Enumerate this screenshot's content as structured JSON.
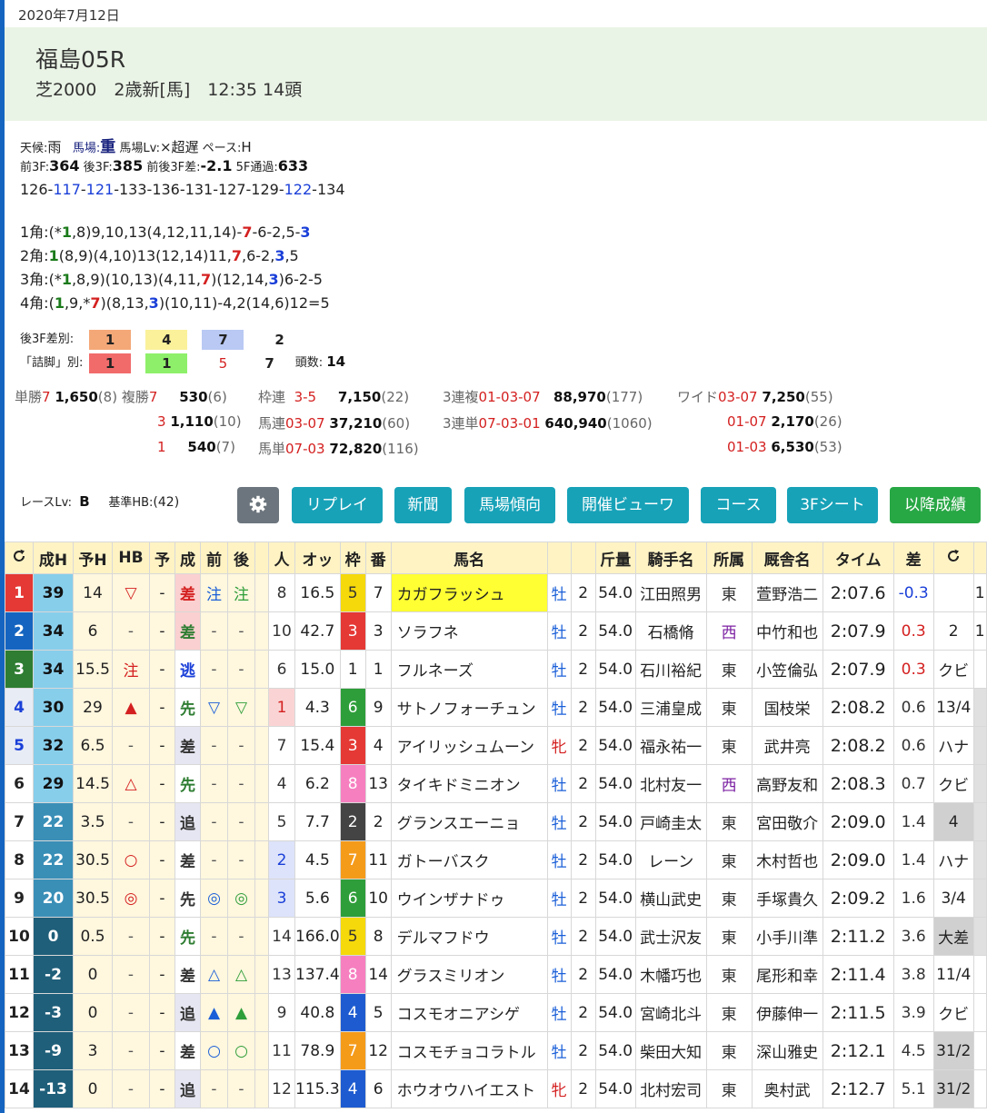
{
  "date": "2020年7月12日",
  "race": {
    "title": "福島05R",
    "detail": "芝2000　2歳新[馬]　12:35 14頭"
  },
  "conditions": {
    "weather_label": "天候:",
    "weather": "雨",
    "track_label": "馬場:",
    "track": "重",
    "tracklv_label": "馬場Lv:",
    "tracklv": "×超遅",
    "pace_label": "ペース:",
    "pace": "H"
  },
  "splits": {
    "f3_label": "前3F:",
    "f3": "364",
    "l3_label": "後3F:",
    "l3": "385",
    "diff_label": "前後3F差:",
    "diff": "-2.1",
    "f5_label": "5F通過:",
    "f5": "633",
    "laps": [
      "126",
      "117",
      "121",
      "133",
      "136",
      "131",
      "127",
      "129",
      "122",
      "134"
    ]
  },
  "corners": [
    "1角:(*1,8)9,10,13(4,12,11,14)-7-6-2,5-3",
    "2角:1(8,9)(4,10)13(12,14)11,7,6-2,3,5",
    "3角:(*1,8,9)(10,13)(4,11,7)(12,14,3)6-2-5",
    "4角:(1,9,*7)(8,13,3)(10,11)-4,2(14,6)12=5"
  ],
  "rank3f": {
    "label": "後3F差別:",
    "values": [
      "1",
      "4",
      "7",
      "2"
    ]
  },
  "tsume": {
    "label": "「詰脚」別:",
    "values": [
      "1",
      "1",
      "5",
      "7"
    ],
    "count_label": "頭数:",
    "count": "14"
  },
  "payouts": {
    "tansho": {
      "label": "単勝",
      "no": "7",
      "pay": "1,650",
      "pop": "(8)"
    },
    "fukusho_label": "複勝",
    "fukusho": [
      {
        "no": "7",
        "pay": "530",
        "pop": "(6)"
      },
      {
        "no": "3",
        "pay": "1,110",
        "pop": "(10)"
      },
      {
        "no": "1",
        "pay": "540",
        "pop": "(7)"
      }
    ],
    "wakuren": {
      "label": "枠連",
      "combo": "3-5",
      "pay": "7,150",
      "pop": "(22)"
    },
    "umaren": {
      "label": "馬連",
      "combo": "03-07",
      "pay": "37,210",
      "pop": "(60)"
    },
    "umatan": {
      "label": "馬単",
      "combo": "07-03",
      "pay": "72,820",
      "pop": "(116)"
    },
    "sanrenpuku": {
      "label": "3連複",
      "combo": "01-03-07",
      "pay": "88,970",
      "pop": "(177)"
    },
    "sanrentan": {
      "label": "3連単",
      "combo": "07-03-01",
      "pay": "640,940",
      "pop": "(1060)"
    },
    "wide_label": "ワイド",
    "wide": [
      {
        "combo": "03-07",
        "pay": "7,250",
        "pop": "(55)"
      },
      {
        "combo": "01-07",
        "pay": "2,170",
        "pop": "(26)"
      },
      {
        "combo": "01-03",
        "pay": "6,530",
        "pop": "(53)"
      }
    ]
  },
  "racelv": {
    "label": "レースLv:",
    "value": "B",
    "hb_label": "基準HB:",
    "hb": "(42)"
  },
  "buttons": [
    "リプレイ",
    "新聞",
    "馬場傾向",
    "開催ビューワ",
    "コース",
    "3Fシート",
    "以降成績"
  ],
  "table": {
    "headers": [
      "成H",
      "予H",
      "HB",
      "予",
      "成",
      "前",
      "後",
      "人",
      "オッ",
      "枠",
      "番",
      "馬名",
      "",
      "",
      "斤量",
      "騎手名",
      "所属",
      "厩舎名",
      "タイム",
      "差"
    ],
    "rows": [
      {
        "rank": "1",
        "seiH": "39",
        "yoH": "14",
        "hb": "▽",
        "yo": "-",
        "sei": "差",
        "mae": "注",
        "ato": "注",
        "pop": "8",
        "odds": "16.5",
        "waku": "5",
        "ban": "7",
        "name": "カガフラッシュ",
        "sex": "牡",
        "age": "2",
        "kin": "54.0",
        "jockey": "江田照男",
        "aff": "東",
        "trainer": "萱野浩二",
        "time": "2:07.6",
        "diff": "-0.3",
        "margin": "",
        "x": "1"
      },
      {
        "rank": "2",
        "seiH": "34",
        "yoH": "6",
        "hb": "-",
        "yo": "-",
        "sei": "差",
        "mae": "-",
        "ato": "-",
        "pop": "10",
        "odds": "42.7",
        "waku": "3",
        "ban": "3",
        "name": "ソラフネ",
        "sex": "牡",
        "age": "2",
        "kin": "54.0",
        "jockey": "石橋脩",
        "aff": "西",
        "trainer": "中竹和也",
        "time": "2:07.9",
        "diff": "0.3",
        "margin": "2",
        "x": "1"
      },
      {
        "rank": "3",
        "seiH": "34",
        "yoH": "15.5",
        "hb": "注",
        "yo": "-",
        "sei": "逃",
        "mae": "-",
        "ato": "-",
        "pop": "6",
        "odds": "15.0",
        "waku": "1",
        "ban": "1",
        "name": "フルネーズ",
        "sex": "牡",
        "age": "2",
        "kin": "54.0",
        "jockey": "石川裕紀",
        "aff": "東",
        "trainer": "小笠倫弘",
        "time": "2:07.9",
        "diff": "0.3",
        "margin": "クビ",
        "x": ""
      },
      {
        "rank": "4",
        "seiH": "30",
        "yoH": "29",
        "hb": "▲",
        "yo": "-",
        "sei": "先",
        "mae": "▽",
        "ato": "▽",
        "pop": "1",
        "odds": "4.3",
        "waku": "6",
        "ban": "9",
        "name": "サトノフォーチュン",
        "sex": "牡",
        "age": "2",
        "kin": "54.0",
        "jockey": "三浦皇成",
        "aff": "東",
        "trainer": "国枝栄",
        "time": "2:08.2",
        "diff": "0.6",
        "margin": "13/4",
        "x": ""
      },
      {
        "rank": "5",
        "seiH": "32",
        "yoH": "6.5",
        "hb": "-",
        "yo": "-",
        "sei": "差",
        "mae": "-",
        "ato": "-",
        "pop": "7",
        "odds": "15.4",
        "waku": "3",
        "ban": "4",
        "name": "アイリッシュムーン",
        "sex": "牝",
        "age": "2",
        "kin": "54.0",
        "jockey": "福永祐一",
        "aff": "東",
        "trainer": "武井亮",
        "time": "2:08.2",
        "diff": "0.6",
        "margin": "ハナ",
        "x": ""
      },
      {
        "rank": "6",
        "seiH": "29",
        "yoH": "14.5",
        "hb": "△",
        "yo": "-",
        "sei": "先",
        "mae": "-",
        "ato": "-",
        "pop": "4",
        "odds": "6.2",
        "waku": "8",
        "ban": "13",
        "name": "タイキドミニオン",
        "sex": "牡",
        "age": "2",
        "kin": "54.0",
        "jockey": "北村友一",
        "aff": "西",
        "trainer": "高野友和",
        "time": "2:08.3",
        "diff": "0.7",
        "margin": "クビ",
        "x": ""
      },
      {
        "rank": "7",
        "seiH": "22",
        "yoH": "3.5",
        "hb": "-",
        "yo": "-",
        "sei": "追",
        "mae": "-",
        "ato": "-",
        "pop": "5",
        "odds": "7.7",
        "waku": "2",
        "ban": "2",
        "name": "グランスエーニョ",
        "sex": "牡",
        "age": "2",
        "kin": "54.0",
        "jockey": "戸崎圭太",
        "aff": "東",
        "trainer": "宮田敬介",
        "time": "2:09.0",
        "diff": "1.4",
        "margin": "4",
        "x": ""
      },
      {
        "rank": "8",
        "seiH": "22",
        "yoH": "30.5",
        "hb": "○",
        "yo": "-",
        "sei": "差",
        "mae": "-",
        "ato": "-",
        "pop": "2",
        "odds": "4.5",
        "waku": "7",
        "ban": "11",
        "name": "ガトーバスク",
        "sex": "牡",
        "age": "2",
        "kin": "54.0",
        "jockey": "レーン",
        "aff": "東",
        "trainer": "木村哲也",
        "time": "2:09.0",
        "diff": "1.4",
        "margin": "ハナ",
        "x": ""
      },
      {
        "rank": "9",
        "seiH": "20",
        "yoH": "30.5",
        "hb": "◎",
        "yo": "-",
        "sei": "先",
        "mae": "◎",
        "ato": "◎",
        "pop": "3",
        "odds": "5.6",
        "waku": "6",
        "ban": "10",
        "name": "ウインザナドゥ",
        "sex": "牡",
        "age": "2",
        "kin": "54.0",
        "jockey": "横山武史",
        "aff": "東",
        "trainer": "手塚貴久",
        "time": "2:09.2",
        "diff": "1.6",
        "margin": "3/4",
        "x": ""
      },
      {
        "rank": "10",
        "seiH": "0",
        "yoH": "0.5",
        "hb": "-",
        "yo": "-",
        "sei": "先",
        "mae": "-",
        "ato": "-",
        "pop": "14",
        "odds": "166.0",
        "waku": "5",
        "ban": "8",
        "name": "デルマフドウ",
        "sex": "牡",
        "age": "2",
        "kin": "54.0",
        "jockey": "武士沢友",
        "aff": "東",
        "trainer": "小手川準",
        "time": "2:11.2",
        "diff": "3.6",
        "margin": "大差",
        "x": ""
      },
      {
        "rank": "11",
        "seiH": "-2",
        "yoH": "0",
        "hb": "-",
        "yo": "-",
        "sei": "差",
        "mae": "△",
        "ato": "△",
        "pop": "13",
        "odds": "137.4",
        "waku": "8",
        "ban": "14",
        "name": "グラスミリオン",
        "sex": "牡",
        "age": "2",
        "kin": "54.0",
        "jockey": "木幡巧也",
        "aff": "東",
        "trainer": "尾形和幸",
        "time": "2:11.4",
        "diff": "3.8",
        "margin": "11/4",
        "x": ""
      },
      {
        "rank": "12",
        "seiH": "-3",
        "yoH": "0",
        "hb": "-",
        "yo": "-",
        "sei": "追",
        "mae": "▲",
        "ato": "▲",
        "pop": "9",
        "odds": "40.8",
        "waku": "4",
        "ban": "5",
        "name": "コスモオニアシゲ",
        "sex": "牡",
        "age": "2",
        "kin": "54.0",
        "jockey": "宮崎北斗",
        "aff": "東",
        "trainer": "伊藤伸一",
        "time": "2:11.5",
        "diff": "3.9",
        "margin": "クビ",
        "x": ""
      },
      {
        "rank": "13",
        "seiH": "-9",
        "yoH": "3",
        "hb": "-",
        "yo": "-",
        "sei": "差",
        "mae": "○",
        "ato": "○",
        "pop": "11",
        "odds": "78.9",
        "waku": "7",
        "ban": "12",
        "name": "コスモチョコラトル",
        "sex": "牡",
        "age": "2",
        "kin": "54.0",
        "jockey": "柴田大知",
        "aff": "東",
        "trainer": "深山雅史",
        "time": "2:12.1",
        "diff": "4.5",
        "margin": "31/2",
        "x": ""
      },
      {
        "rank": "14",
        "seiH": "-13",
        "yoH": "0",
        "hb": "-",
        "yo": "-",
        "sei": "追",
        "mae": "-",
        "ato": "-",
        "pop": "12",
        "odds": "115.3",
        "waku": "4",
        "ban": "6",
        "name": "ホウオウハイエスト",
        "sex": "牝",
        "age": "2",
        "kin": "54.0",
        "jockey": "北村宏司",
        "aff": "東",
        "trainer": "奥村武",
        "time": "2:12.7",
        "diff": "5.1",
        "margin": "31/2",
        "x": ""
      }
    ]
  }
}
